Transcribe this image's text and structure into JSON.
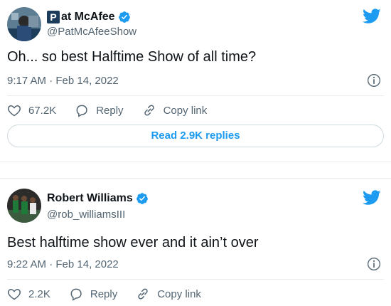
{
  "tweets": [
    {
      "name": "Pat McAfee",
      "name_prefix": "P",
      "name_rest": "at McAfee",
      "handle": "@PatMcAfeeShow",
      "text": "Oh... so best Halftime Show of all time?",
      "timestamp": "9:17 AM · Feb 14, 2022",
      "likes": "67.2K",
      "reply_label": "Reply",
      "copy_link_label": "Copy link",
      "read_replies_label": "Read 2.9K replies"
    },
    {
      "name": "Robert Williams",
      "handle": "@rob_williamsIII",
      "text": "Best halftime show ever and it ain’t over",
      "timestamp": "9:22 AM · Feb 14, 2022",
      "likes": "2.2K",
      "reply_label": "Reply",
      "copy_link_label": "Copy link"
    }
  ],
  "colors": {
    "accent": "#1d9bf0",
    "muted": "#536471",
    "text": "#0f1419",
    "border": "#e6ecf0"
  },
  "icons": [
    "twitter-bird-icon",
    "verified-badge-icon",
    "heart-icon",
    "reply-icon",
    "link-icon",
    "info-icon"
  ]
}
